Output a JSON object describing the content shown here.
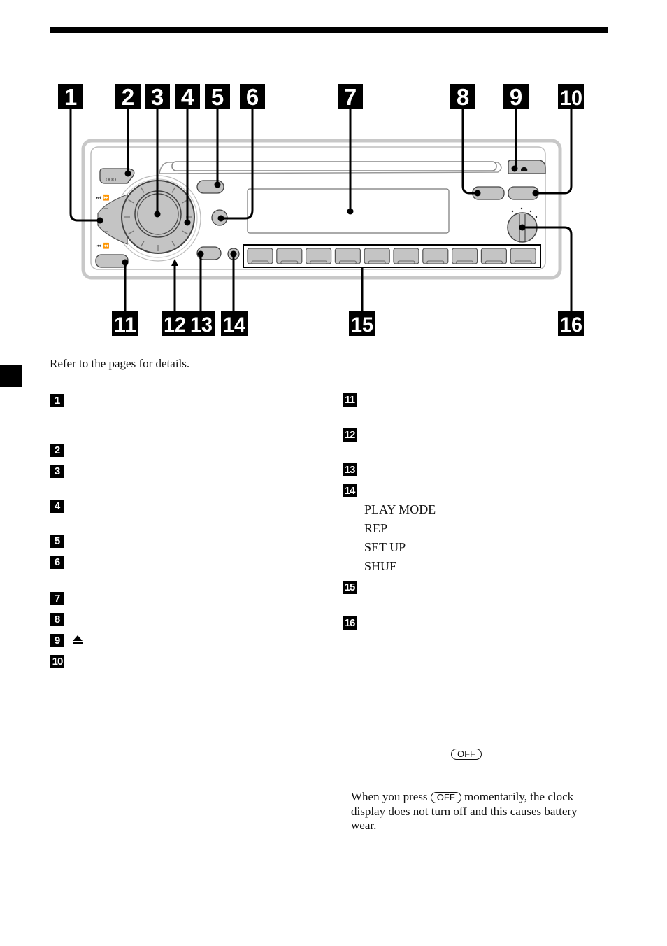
{
  "page": {
    "intro_text": "Refer to the pages for details."
  },
  "diagram": {
    "callouts": [
      "1",
      "2",
      "3",
      "4",
      "5",
      "6",
      "7",
      "8",
      "9",
      "10",
      "11",
      "12",
      "13",
      "14",
      "15",
      "16"
    ],
    "button_ooo_label": "ooo",
    "seek_up_label": "⏭ ⏩",
    "seek_down_label": "⏮ ⏪",
    "plus_label": "+",
    "minus_label": "–",
    "eject_symbol": "⏏",
    "preset_count": 10,
    "colors": {
      "button_fill": "#c4c4c4",
      "panel_outline": "#b8b8b8",
      "callout": "#000000"
    }
  },
  "legend_left": [
    {
      "num": "1"
    },
    {
      "num": "2"
    },
    {
      "num": "3"
    },
    {
      "num": "4"
    },
    {
      "num": "5"
    },
    {
      "num": "6"
    },
    {
      "num": "7"
    },
    {
      "num": "8"
    },
    {
      "num": "9",
      "symbol": "eject-icon"
    },
    {
      "num": "10"
    }
  ],
  "legend_right": [
    {
      "num": "11"
    },
    {
      "num": "12"
    },
    {
      "num": "13"
    },
    {
      "num": "14",
      "subitems": [
        "PLAY MODE",
        "REP",
        "SET UP",
        "SHUF"
      ]
    },
    {
      "num": "15"
    },
    {
      "num": "16"
    }
  ],
  "note": {
    "off_key_label": "OFF",
    "text_before": "When you press ",
    "key_label": "OFF",
    "text_after": " momentarily, the clock display does not turn off and this causes battery wear."
  }
}
